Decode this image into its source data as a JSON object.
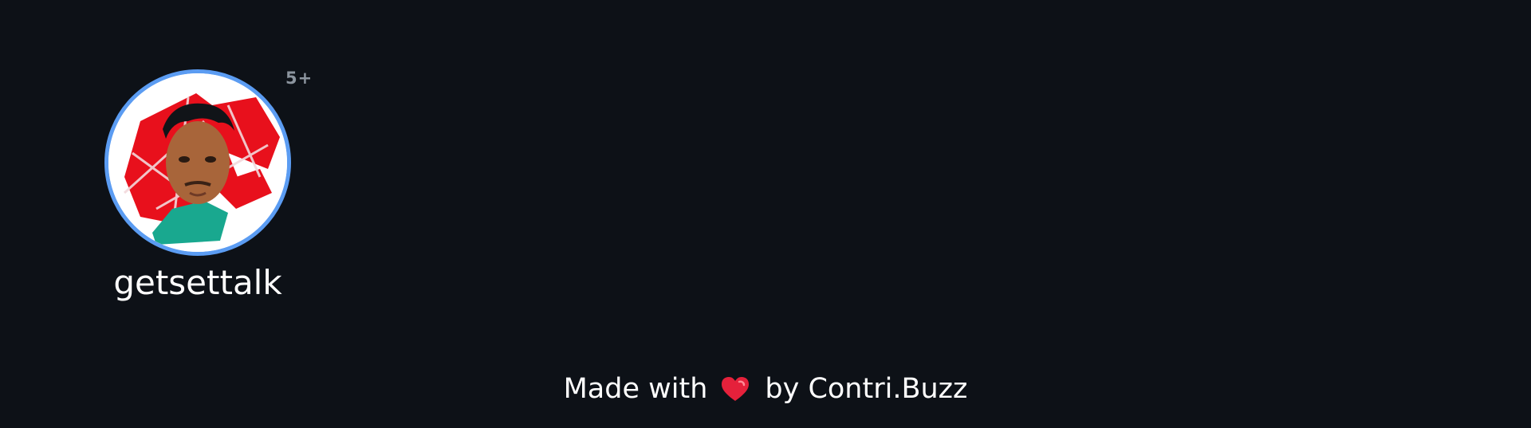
{
  "contributors": [
    {
      "username": "getsettalk",
      "badge": "5+",
      "ring_color": "#5b9cf2"
    }
  ],
  "footer": {
    "prefix": "Made with",
    "heart_icon": "heart-icon",
    "by_text": "by",
    "brand": "Contri.Buzz"
  },
  "colors": {
    "background": "#0d1117",
    "text": "#ffffff",
    "badge": "#8b949e",
    "heart": "#e5213b"
  }
}
